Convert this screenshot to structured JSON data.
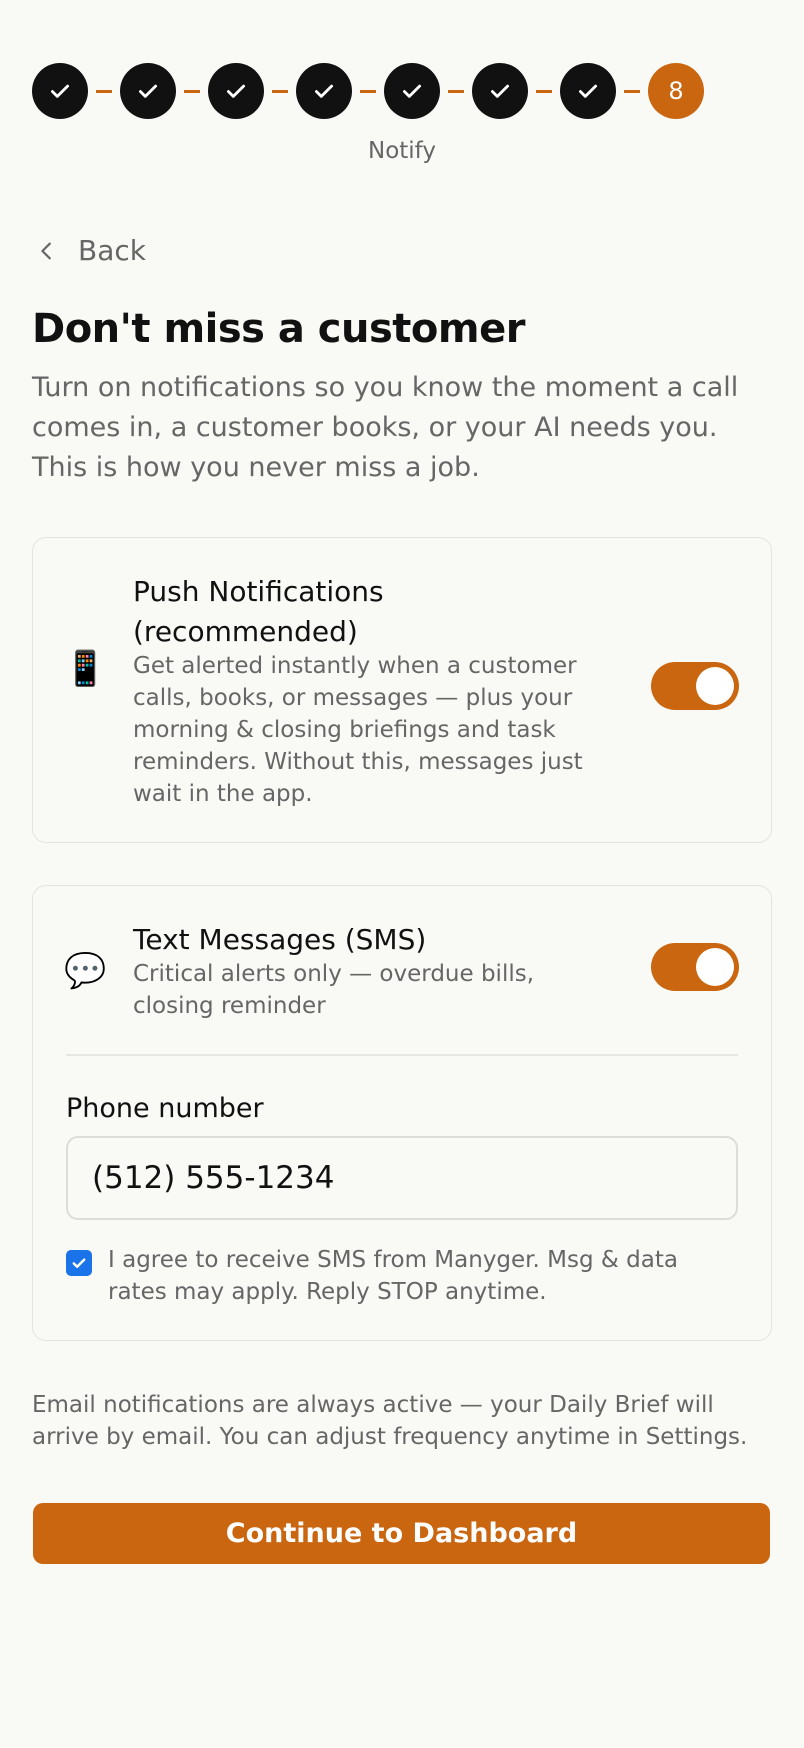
{
  "stepper": {
    "completed_steps": 7,
    "current_step_number": "8",
    "current_step_label": "Notify",
    "accent_color": "#c9660f",
    "completed_color": "#111111",
    "completed_icon": "checkmark-icon"
  },
  "nav": {
    "back_label": "Back",
    "back_icon": "chevron-left-icon"
  },
  "header": {
    "title": "Don't miss a customer",
    "intro": "Turn on notifications so you know the moment a call comes in, a customer books, or your AI needs you. This is how you never miss a job."
  },
  "push": {
    "icon": "📱",
    "icon_name": "mobile-phone-icon",
    "title_line1": "Push Notifications",
    "title_line2": "(recommended)",
    "description": "Get alerted instantly when a customer calls, books, or messages — plus your morning & closing briefings and task reminders. Without this, messages just wait in the app.",
    "enabled": true
  },
  "sms": {
    "icon": "💬",
    "icon_name": "speech-bubble-icon",
    "title": "Text Messages (SMS)",
    "description": "Critical alerts only — overdue bills, closing reminder",
    "enabled": true,
    "phone_label": "Phone number",
    "phone_value": "(512) 555-1234",
    "consent_checked": true,
    "consent_text": "I agree to receive SMS from Manyger. Msg & data rates may apply. Reply STOP anytime."
  },
  "footnote": "Email notifications are always active — your Daily Brief will arrive by email. You can adjust frequency anytime in Settings.",
  "cta_label": "Continue to Dashboard"
}
